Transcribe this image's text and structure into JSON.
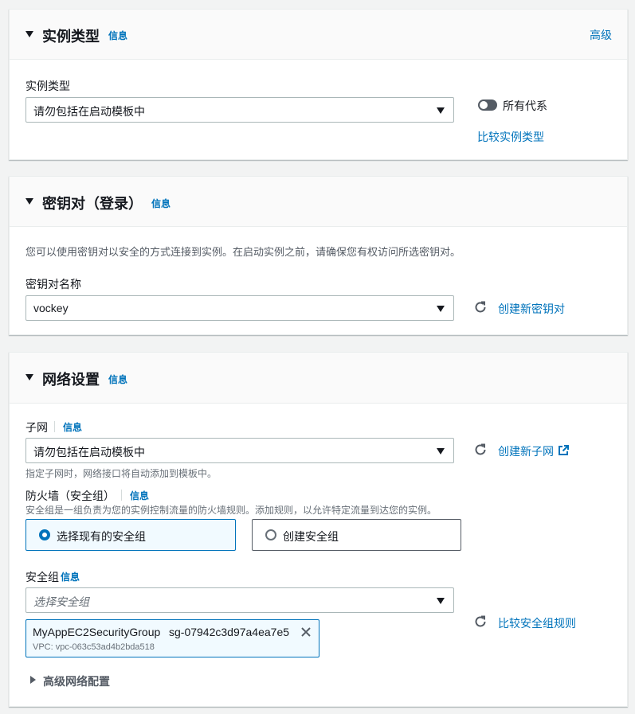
{
  "instance_type_section": {
    "title": "实例类型",
    "info": "信息",
    "advanced": "高级",
    "field_label": "实例类型",
    "select_value": "请勿包括在启动模板中",
    "toggle_label": "所有代系",
    "compare_link": "比较实例类型"
  },
  "key_pair_section": {
    "title": "密钥对（登录）",
    "info": "信息",
    "description": "您可以使用密钥对以安全的方式连接到实例。在启动实例之前，请确保您有权访问所选密钥对。",
    "field_label": "密钥对名称",
    "select_value": "vockey",
    "create_link": "创建新密钥对"
  },
  "network_section": {
    "title": "网络设置",
    "info": "信息",
    "subnet": {
      "label": "子网",
      "info": "信息",
      "select_value": "请勿包括在启动模板中",
      "create_link": "创建新子网",
      "hint": "指定子网时，网络接口将自动添加到模板中。"
    },
    "firewall": {
      "label": "防火墙（安全组）",
      "info": "信息",
      "description": "安全组是一组负责为您的实例控制流量的防火墙规则。添加规则，以允许特定流量到达您的实例。",
      "options": [
        {
          "label": "选择现有的安全组",
          "selected": true
        },
        {
          "label": "创建安全组",
          "selected": false
        }
      ]
    },
    "security_group": {
      "label": "安全组",
      "info": "信息",
      "placeholder": "选择安全组",
      "compare_link": "比较安全组规则",
      "token": {
        "name": "MyAppEC2SecurityGroup",
        "id": "sg-07942c3d97a4ea7e5",
        "vpc": "VPC: vpc-063c53ad4b2bda518"
      }
    },
    "advanced_toggle": "高级网络配置"
  },
  "colors": {
    "link": "#0073bb",
    "selected_bg": "#f1faff",
    "border": "#aab7b8"
  }
}
